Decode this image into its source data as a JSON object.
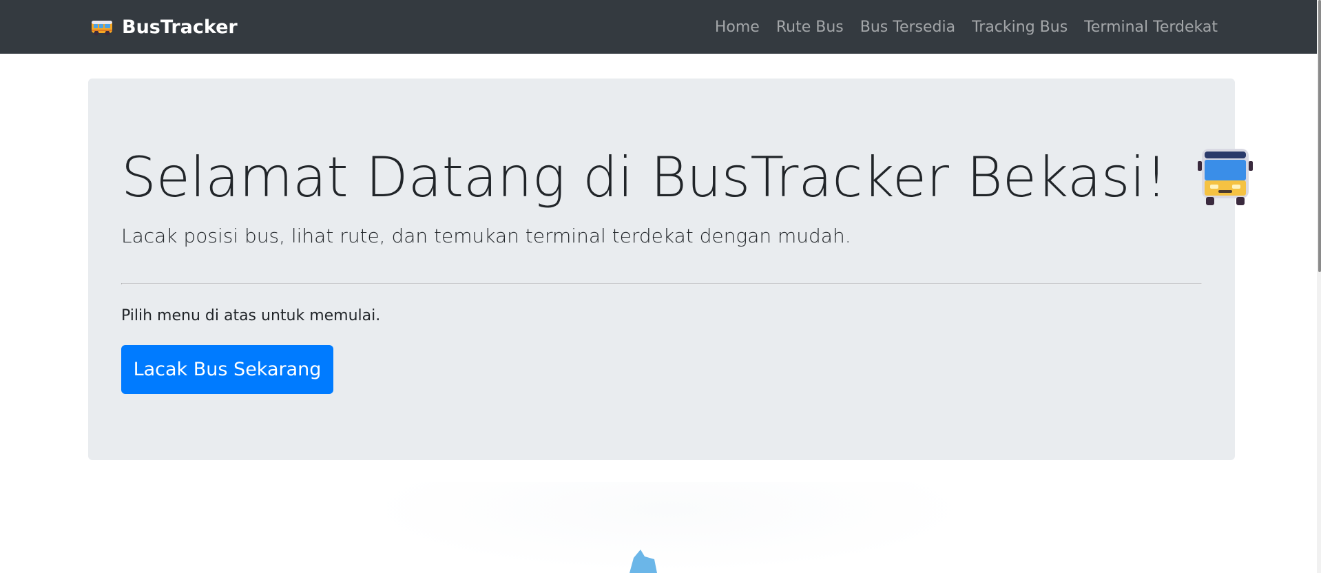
{
  "navbar": {
    "brand": "BusTracker",
    "brand_icon": "bus-icon",
    "links": [
      {
        "label": "Home"
      },
      {
        "label": "Rute Bus"
      },
      {
        "label": "Bus Tersedia"
      },
      {
        "label": "Tracking Bus"
      },
      {
        "label": "Terminal Terdekat"
      }
    ]
  },
  "hero": {
    "title": "Selamat Datang di BusTracker Bekasi!",
    "title_icon": "bus-front-icon",
    "lead": "Lacak posisi bus, lihat rute, dan temukan terminal terdekat dengan mudah.",
    "body": "Pilih menu di atas untuk memulai.",
    "button_label": "Lacak Bus Sekarang"
  },
  "colors": {
    "navbar_bg": "#343a40",
    "jumbotron_bg": "#e9ecef",
    "primary": "#007bff",
    "nav_link": "#9a9da0"
  }
}
